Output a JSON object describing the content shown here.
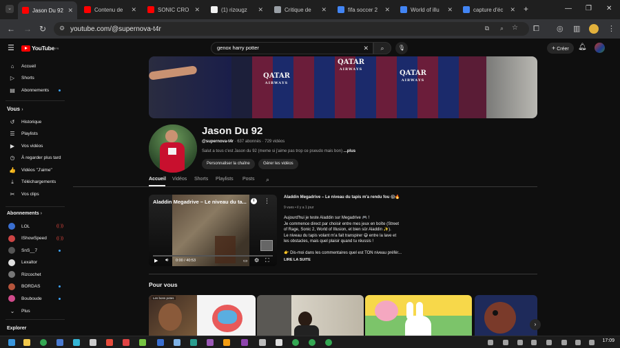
{
  "browser": {
    "tabs": [
      {
        "label": "Jason Du 92",
        "color": "#ff0000"
      },
      {
        "label": "Contenu de",
        "color": "#ff0000"
      },
      {
        "label": "SONIC CRO",
        "color": "#ff0000"
      },
      {
        "label": "(1) rizougz",
        "color": "#f1f1f1"
      },
      {
        "label": "Critique de",
        "color": "#9aa0a6"
      },
      {
        "label": "fifa soccer 2",
        "color": "#4285f4"
      },
      {
        "label": "World of illu",
        "color": "#4285f4"
      },
      {
        "label": "capture d'éc",
        "color": "#4285f4"
      }
    ],
    "new_tab": "+",
    "url": "youtube.com/@supernova-t4r"
  },
  "youtube": {
    "logo_text": "YouTube",
    "logo_country": "FR",
    "search_value": "genox harry potter",
    "create_label": "Créer"
  },
  "sidebar": {
    "main": [
      {
        "label": "Accueil",
        "icon": "⌂"
      },
      {
        "label": "Shorts",
        "icon": "▷"
      },
      {
        "label": "Abonnements",
        "icon": "▤"
      }
    ],
    "you_header": "Vous",
    "you": [
      {
        "label": "Historique",
        "icon": "↺"
      },
      {
        "label": "Playlists",
        "icon": "☰"
      },
      {
        "label": "Vos vidéos",
        "icon": "▶"
      },
      {
        "label": "À regarder plus tard",
        "icon": "◷"
      },
      {
        "label": "Vidéos \"J'aime\"",
        "icon": "👍"
      },
      {
        "label": "Téléchargements",
        "icon": "⤓"
      },
      {
        "label": "Vos clips",
        "icon": "✂"
      }
    ],
    "subs_header": "Abonnements",
    "subs": [
      {
        "label": "LOL",
        "color": "#3a6fd1",
        "status": "live"
      },
      {
        "label": "IShowSpeed",
        "color": "#c44",
        "status": "live"
      },
      {
        "label": "SnS__7",
        "color": "#555",
        "status": "dot"
      },
      {
        "label": "Lexaltor",
        "color": "#e0e0e0",
        "status": "none"
      },
      {
        "label": "Rizcochet",
        "color": "#777",
        "status": "none"
      },
      {
        "label": "BORDAS",
        "color": "#b5543b",
        "status": "dot"
      },
      {
        "label": "Bouboude",
        "color": "#d04a8a",
        "status": "dot"
      }
    ],
    "more_label": "Plus",
    "explore_header": "Explorer",
    "live_glyph": "((·))"
  },
  "channel": {
    "name": "Jason Du 92",
    "handle": "@supernova-t4r",
    "meta": " · 637 abonnés · 729 vidéos",
    "description": "Salut a tous c'est Jason du 92  (meme si j'aime pas trop ce pseudo mais bon) ",
    "desc_more": "...plus",
    "btn_customize": "Personnaliser la chaîne",
    "btn_manage": "Gérer les vidéos",
    "banner_sponsor": "QATAR",
    "banner_sponsor_sub": "AIRWAYS",
    "tabs": [
      "Accueil",
      "Vidéos",
      "Shorts",
      "Playlists",
      "Posts"
    ]
  },
  "featured": {
    "player_title": "Aladdin Megadrive – Le niveau du ta...",
    "time": "0:00 / 40:53",
    "title": "Aladdin Megadrive – Le niveau du tapis m'a rendu fou 😱🔥",
    "meta": "9 vues • il y a 1 jour",
    "description_lines": [
      "Aujourd'hui je teste Aladdin sur Megadrive 🎮 !",
      "Je commence direct par choisir entre mes jeux en boîte (Street",
      "of Rage, Sonic 2, World of Illusion, et bien sûr Aladdin ✨).",
      "Le niveau du tapis volant m'a fait transpirer 😅 entre la lave et",
      "les obstacles, mais quel plaisir quand tu réussis !",
      "",
      "👉 Dis-moi dans les commentaires quel est TON niveau préfér..."
    ],
    "read_more": "LIRE LA SUITE"
  },
  "feed": {
    "header": "Pour vous",
    "first_badge": "Les bons potes"
  },
  "taskbar": {
    "time": "17:09"
  }
}
